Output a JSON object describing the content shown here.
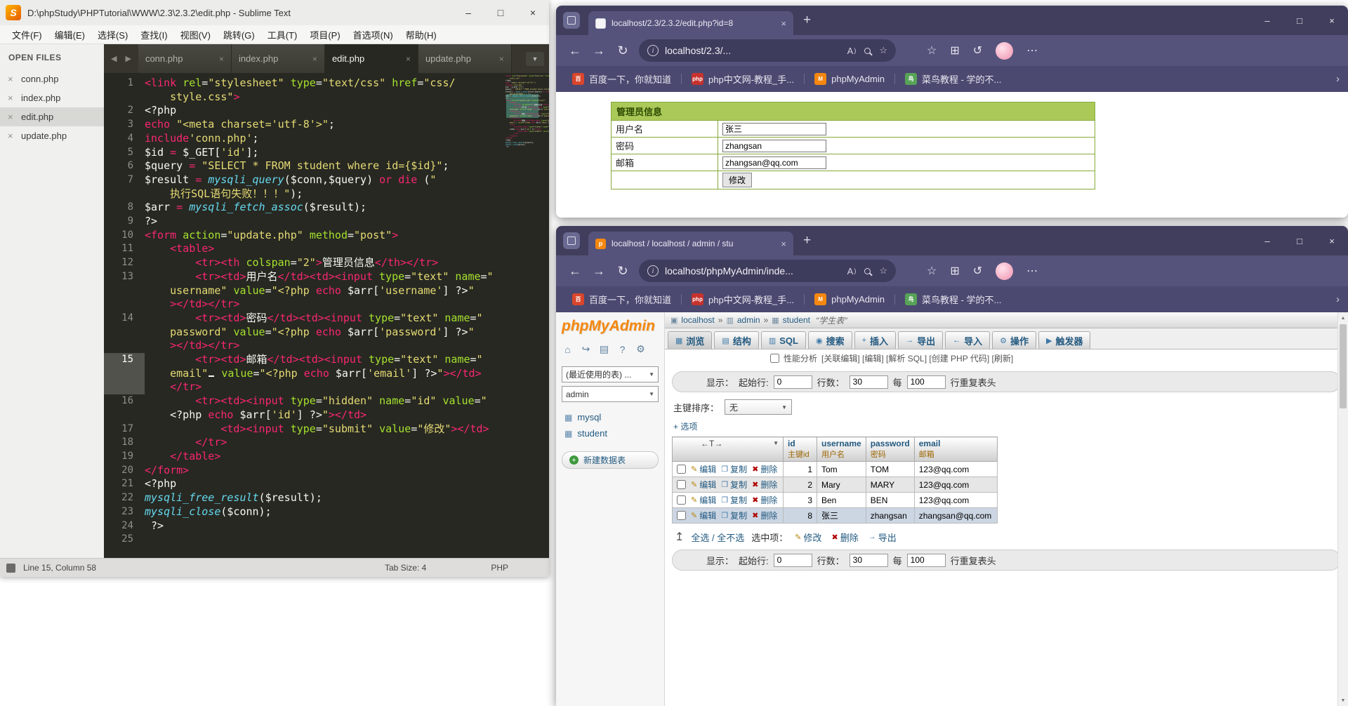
{
  "colors": {
    "monokai_bg": "#272822",
    "edge_chrome": "#55537b",
    "pma_link": "#235a81",
    "form_header_green": "#abc959"
  },
  "sublime": {
    "title": "D:\\phpStudy\\PHPTutorial\\WWW\\2.3\\2.3.2\\edit.php - Sublime Text",
    "menu": [
      "文件(F)",
      "编辑(E)",
      "选择(S)",
      "查找(I)",
      "视图(V)",
      "跳转(G)",
      "工具(T)",
      "项目(P)",
      "首选项(N)",
      "帮助(H)"
    ],
    "open_files_label": "OPEN FILES",
    "open_files": [
      "conn.php",
      "index.php",
      "edit.php",
      "update.php"
    ],
    "tabs": [
      "conn.php",
      "index.php",
      "edit.php",
      "update.php"
    ],
    "active_file": "edit.php",
    "status": {
      "left": "Line 15, Column 58",
      "tab_size": "Tab Size: 4",
      "syntax": "PHP"
    },
    "code_lines": [
      {
        "n": "1",
        "s": [
          [
            "t",
            "<link"
          ],
          [
            "w",
            " "
          ],
          [
            "a",
            "rel"
          ],
          [
            "w",
            "="
          ],
          [
            "s",
            "\"stylesheet\""
          ],
          [
            "w",
            " "
          ],
          [
            "a",
            "type"
          ],
          [
            "w",
            "="
          ],
          [
            "s",
            "\"text/css\""
          ],
          [
            "w",
            " "
          ],
          [
            "a",
            "href"
          ],
          [
            "w",
            "="
          ],
          [
            "s",
            "\"css/"
          ]
        ]
      },
      {
        "n": "",
        "s": [
          [
            "w",
            "    "
          ],
          [
            "s",
            "style.css\""
          ],
          [
            "t",
            ">"
          ]
        ]
      },
      {
        "n": "2",
        "s": [
          [
            "w",
            "<?php"
          ]
        ]
      },
      {
        "n": "3",
        "s": [
          [
            "t",
            "echo"
          ],
          [
            "w",
            " "
          ],
          [
            "s",
            "\"<meta charset='utf-8'>\""
          ],
          [
            "w",
            ";"
          ]
        ]
      },
      {
        "n": "4",
        "s": [
          [
            "t",
            "include"
          ],
          [
            "s",
            "'conn.php'"
          ],
          [
            "w",
            ";"
          ]
        ]
      },
      {
        "n": "5",
        "s": [
          [
            "w",
            "$id "
          ],
          [
            "t",
            "="
          ],
          [
            "w",
            " $_GET["
          ],
          [
            "s",
            "'id'"
          ],
          [
            "w",
            "];"
          ]
        ]
      },
      {
        "n": "6",
        "s": [
          [
            "w",
            "$query "
          ],
          [
            "t",
            "="
          ],
          [
            "w",
            " "
          ],
          [
            "s",
            "\"SELECT * FROM student where id={$id}\""
          ],
          [
            "w",
            ";"
          ]
        ]
      },
      {
        "n": "7",
        "s": [
          [
            "w",
            "$result "
          ],
          [
            "t",
            "="
          ],
          [
            "w",
            " "
          ],
          [
            "f",
            "mysqli_query"
          ],
          [
            "w",
            "($conn,$query) "
          ],
          [
            "t",
            "or"
          ],
          [
            "w",
            " "
          ],
          [
            "t",
            "die"
          ],
          [
            "w",
            " ("
          ],
          [
            "s",
            "\""
          ]
        ]
      },
      {
        "n": "",
        "s": [
          [
            "w",
            "    "
          ],
          [
            "s",
            "执行SQL语句失败！！！\""
          ],
          [
            "w",
            ");"
          ]
        ]
      },
      {
        "n": "8",
        "s": [
          [
            "w",
            "$arr "
          ],
          [
            "t",
            "="
          ],
          [
            "w",
            " "
          ],
          [
            "f",
            "mysqli_fetch_assoc"
          ],
          [
            "w",
            "($result);"
          ]
        ]
      },
      {
        "n": "9",
        "s": [
          [
            "w",
            "?>"
          ]
        ]
      },
      {
        "n": "10",
        "s": [
          [
            "t",
            "<form"
          ],
          [
            "w",
            " "
          ],
          [
            "a",
            "action"
          ],
          [
            "w",
            "="
          ],
          [
            "s",
            "\"update.php\""
          ],
          [
            "w",
            " "
          ],
          [
            "a",
            "method"
          ],
          [
            "w",
            "="
          ],
          [
            "s",
            "\"post\""
          ],
          [
            "t",
            ">"
          ]
        ]
      },
      {
        "n": "11",
        "s": [
          [
            "w",
            "    "
          ],
          [
            "t",
            "<table>"
          ]
        ]
      },
      {
        "n": "12",
        "s": [
          [
            "w",
            "        "
          ],
          [
            "t",
            "<tr><th"
          ],
          [
            "w",
            " "
          ],
          [
            "a",
            "colspan"
          ],
          [
            "w",
            "="
          ],
          [
            "s",
            "\"2\""
          ],
          [
            "t",
            ">"
          ],
          [
            "w",
            "管理员信息"
          ],
          [
            "t",
            "</th></tr>"
          ]
        ]
      },
      {
        "n": "13",
        "s": [
          [
            "w",
            "        "
          ],
          [
            "t",
            "<tr><td>"
          ],
          [
            "w",
            "用户名"
          ],
          [
            "t",
            "</td><td><input"
          ],
          [
            "w",
            " "
          ],
          [
            "a",
            "type"
          ],
          [
            "w",
            "="
          ],
          [
            "s",
            "\"text\""
          ],
          [
            "w",
            " "
          ],
          [
            "a",
            "name"
          ],
          [
            "w",
            "="
          ],
          [
            "s",
            "\""
          ]
        ]
      },
      {
        "n": "",
        "s": [
          [
            "w",
            "    "
          ],
          [
            "s",
            "username\""
          ],
          [
            "w",
            " "
          ],
          [
            "a",
            "value"
          ],
          [
            "w",
            "="
          ],
          [
            "s",
            "\"<?php "
          ],
          [
            "t",
            "echo"
          ],
          [
            "w",
            " $arr["
          ],
          [
            "s",
            "'username'"
          ],
          [
            "w",
            "] ?>"
          ],
          [
            "s",
            "\""
          ]
        ]
      },
      {
        "n": "",
        "s": [
          [
            "w",
            "    "
          ],
          [
            "t",
            "></td></tr>"
          ]
        ]
      },
      {
        "n": "14",
        "s": [
          [
            "w",
            "        "
          ],
          [
            "t",
            "<tr><td>"
          ],
          [
            "w",
            "密码"
          ],
          [
            "t",
            "</td><td><input"
          ],
          [
            "w",
            " "
          ],
          [
            "a",
            "type"
          ],
          [
            "w",
            "="
          ],
          [
            "s",
            "\"text\""
          ],
          [
            "w",
            " "
          ],
          [
            "a",
            "name"
          ],
          [
            "w",
            "="
          ],
          [
            "s",
            "\""
          ]
        ]
      },
      {
        "n": "",
        "s": [
          [
            "w",
            "    "
          ],
          [
            "s",
            "password\""
          ],
          [
            "w",
            " "
          ],
          [
            "a",
            "value"
          ],
          [
            "w",
            "="
          ],
          [
            "s",
            "\"<?php "
          ],
          [
            "t",
            "echo"
          ],
          [
            "w",
            " $arr["
          ],
          [
            "s",
            "'password'"
          ],
          [
            "w",
            "] ?>"
          ],
          [
            "s",
            "\""
          ]
        ]
      },
      {
        "n": "",
        "s": [
          [
            "w",
            "    "
          ],
          [
            "t",
            "></td></tr>"
          ]
        ]
      },
      {
        "n": "15",
        "cur": true,
        "s": [
          [
            "w",
            "        "
          ],
          [
            "t",
            "<tr><td>"
          ],
          [
            "w",
            "邮箱"
          ],
          [
            "t",
            "</td><td><input"
          ],
          [
            "w",
            " "
          ],
          [
            "a",
            "type"
          ],
          [
            "w",
            "="
          ],
          [
            "s",
            "\"text\""
          ],
          [
            "w",
            " "
          ],
          [
            "a",
            "name"
          ],
          [
            "w",
            "="
          ],
          [
            "s",
            "\""
          ]
        ]
      },
      {
        "n": "",
        "cur": true,
        "s": [
          [
            "w",
            "    "
          ],
          [
            "s",
            "email\""
          ],
          [
            "caret",
            ""
          ],
          [
            "w",
            " "
          ],
          [
            "a",
            "value"
          ],
          [
            "w",
            "="
          ],
          [
            "s",
            "\"<?php "
          ],
          [
            "t",
            "echo"
          ],
          [
            "w",
            " $arr["
          ],
          [
            "s",
            "'email'"
          ],
          [
            "w",
            "] ?>"
          ],
          [
            "s",
            "\""
          ],
          [
            "t",
            "></td>"
          ]
        ]
      },
      {
        "n": "",
        "cur": true,
        "s": [
          [
            "w",
            "    "
          ],
          [
            "t",
            "</tr>"
          ]
        ]
      },
      {
        "n": "16",
        "s": [
          [
            "w",
            "        "
          ],
          [
            "t",
            "<tr><td><input"
          ],
          [
            "w",
            " "
          ],
          [
            "a",
            "type"
          ],
          [
            "w",
            "="
          ],
          [
            "s",
            "\"hidden\""
          ],
          [
            "w",
            " "
          ],
          [
            "a",
            "name"
          ],
          [
            "w",
            "="
          ],
          [
            "s",
            "\"id\""
          ],
          [
            "w",
            " "
          ],
          [
            "a",
            "value"
          ],
          [
            "w",
            "="
          ],
          [
            "s",
            "\""
          ]
        ]
      },
      {
        "n": "",
        "s": [
          [
            "w",
            "    <?php "
          ],
          [
            "t",
            "echo"
          ],
          [
            "w",
            " $arr["
          ],
          [
            "s",
            "'id'"
          ],
          [
            "w",
            "] ?>"
          ],
          [
            "s",
            "\""
          ],
          [
            "t",
            "></td>"
          ]
        ]
      },
      {
        "n": "17",
        "s": [
          [
            "w",
            "            "
          ],
          [
            "t",
            "<td><input"
          ],
          [
            "w",
            " "
          ],
          [
            "a",
            "type"
          ],
          [
            "w",
            "="
          ],
          [
            "s",
            "\"submit\""
          ],
          [
            "w",
            " "
          ],
          [
            "a",
            "value"
          ],
          [
            "w",
            "="
          ],
          [
            "s",
            "\"修改\""
          ],
          [
            "t",
            "></td>"
          ]
        ]
      },
      {
        "n": "18",
        "s": [
          [
            "w",
            "        "
          ],
          [
            "t",
            "</tr>"
          ]
        ]
      },
      {
        "n": "19",
        "s": [
          [
            "w",
            "    "
          ],
          [
            "t",
            "</table>"
          ]
        ]
      },
      {
        "n": "20",
        "s": [
          [
            "t",
            "</form>"
          ]
        ]
      },
      {
        "n": "21",
        "s": [
          [
            "w",
            "<?php"
          ]
        ]
      },
      {
        "n": "22",
        "s": [
          [
            "f",
            "mysqli_free_result"
          ],
          [
            "w",
            "($result);"
          ]
        ]
      },
      {
        "n": "23",
        "s": [
          [
            "f",
            "mysqli_close"
          ],
          [
            "w",
            "($conn);"
          ]
        ]
      },
      {
        "n": "24",
        "s": [
          [
            "w",
            " ?>"
          ]
        ]
      },
      {
        "n": "25",
        "s": []
      }
    ]
  },
  "edge": {
    "bookmarks": [
      {
        "label": "百度一下，你就知道",
        "glyph": "百",
        "color": "#d9452c"
      },
      {
        "label": "php中文网-教程_手...",
        "glyph": "php",
        "color": "#c7322e"
      },
      {
        "label": "phpMyAdmin",
        "glyph": "M",
        "color": "#f5870f"
      },
      {
        "label": "菜鸟教程 - 学的不...",
        "glyph": "鸟",
        "color": "#57a358"
      }
    ]
  },
  "browser_top": {
    "tab_title": "localhost/2.3/2.3.2/edit.php?id=8",
    "url": "localhost/2.3/...",
    "page": {
      "header": "管理员信息",
      "rows": [
        {
          "label": "用户名",
          "value": "张三",
          "name": "username-input"
        },
        {
          "label": "密码",
          "value": "zhangsan",
          "name": "password-input"
        },
        {
          "label": "邮箱",
          "value": "zhangsan@qq.com",
          "name": "email-input"
        }
      ],
      "submit": "修改"
    }
  },
  "browser_bottom": {
    "tab_title": "localhost / localhost / admin / stu",
    "url": "localhost/phpMyAdmin/inde..."
  },
  "pma": {
    "logo": "phpMyAdmin",
    "recent_tables_select": "(最近使用的表) ...",
    "db_select": "admin",
    "tree": [
      "mysql",
      "student"
    ],
    "new_table": "新建数据表",
    "crumb": {
      "server": "localhost",
      "db": "admin",
      "table": "student",
      "comment": "\"学生表\""
    },
    "tabs": [
      {
        "label": "浏览",
        "icon": "browse",
        "active": true
      },
      {
        "label": "结构",
        "icon": "structure"
      },
      {
        "label": "SQL",
        "icon": "sql"
      },
      {
        "label": "搜索",
        "icon": "search"
      },
      {
        "label": "插入",
        "icon": "insert"
      },
      {
        "label": "导出",
        "icon": "export"
      },
      {
        "label": "导入",
        "icon": "import"
      },
      {
        "label": "操作",
        "icon": "operations"
      },
      {
        "label": "触发器",
        "icon": "triggers"
      }
    ],
    "query_opts": {
      "profiling": "性能分析",
      "links": "[关联编辑] [编辑] [解析 SQL] [创建 PHP 代码] [刷新]"
    },
    "show": {
      "label": "显示：",
      "start_label": "起始行:",
      "start": "0",
      "rows_label": "行数：",
      "rows": "30",
      "per": "每",
      "per_val": "100",
      "suffix": "行重复表头"
    },
    "sort": {
      "label": "主键排序：",
      "value": "无"
    },
    "options_link": "+ 选项",
    "table": {
      "corner": "←T→",
      "columns": [
        {
          "name": "id",
          "sub": "主键id"
        },
        {
          "name": "username",
          "sub": "用户名"
        },
        {
          "name": "password",
          "sub": "密码"
        },
        {
          "name": "email",
          "sub": "邮箱"
        }
      ],
      "row_actions": [
        {
          "label": "编辑",
          "icon": "edit"
        },
        {
          "label": "复制",
          "icon": "copy"
        },
        {
          "label": "删除",
          "icon": "delete"
        }
      ],
      "rows": [
        {
          "values": [
            "1",
            "Tom",
            "TOM",
            "123@qq.com"
          ]
        },
        {
          "values": [
            "2",
            "Mary",
            "MARY",
            "123@qq.com"
          ]
        },
        {
          "values": [
            "3",
            "Ben",
            "BEN",
            "123@qq.com"
          ]
        },
        {
          "values": [
            "8",
            "张三",
            "zhangsan",
            "zhangsan@qq.com"
          ],
          "highlight": true
        }
      ]
    },
    "footer": {
      "check_all": "全选 / 全不选",
      "with_selected": "选中项：",
      "actions": [
        {
          "label": "修改",
          "icon": "edit"
        },
        {
          "label": "删除",
          "icon": "delete"
        },
        {
          "label": "导出",
          "icon": "export"
        }
      ]
    }
  }
}
